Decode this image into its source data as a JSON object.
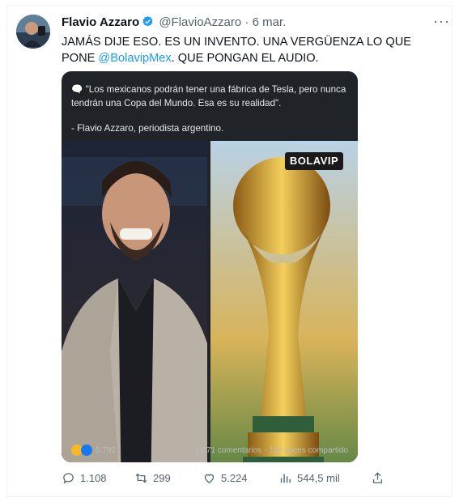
{
  "tweet": {
    "display_name": "Flavio Azzaro",
    "handle": "@FlavioAzzaro",
    "separator": "·",
    "date": "6 mar.",
    "text_main": "JAMÁS DIJE ESO. ES UN INVENTO. UNA VERGÜENZA LO QUE PONE ",
    "mention": "@BolavipMex",
    "text_end": ". QUE PONGAN EL AUDIO.",
    "more_label": "···"
  },
  "embedded": {
    "quote_line": "🗨️ \"Los mexicanos podrán tener una fábrica de Tesla, pero nunca tendrán una Copa del Mundo. Esa es su realidad\".",
    "quote_author": "- Flavio Azzaro, periodista argentino.",
    "logo_text": "BOLAVIP",
    "reactions_count": "5.792",
    "comments_shares": "1.071 comentarios · 152 veces compartido"
  },
  "actions": {
    "replies": "1.108",
    "retweets": "299",
    "likes": "5.224",
    "views": "544,5 mil"
  },
  "colors": {
    "accent": "#1d9bf0",
    "card_bg": "#202327"
  }
}
